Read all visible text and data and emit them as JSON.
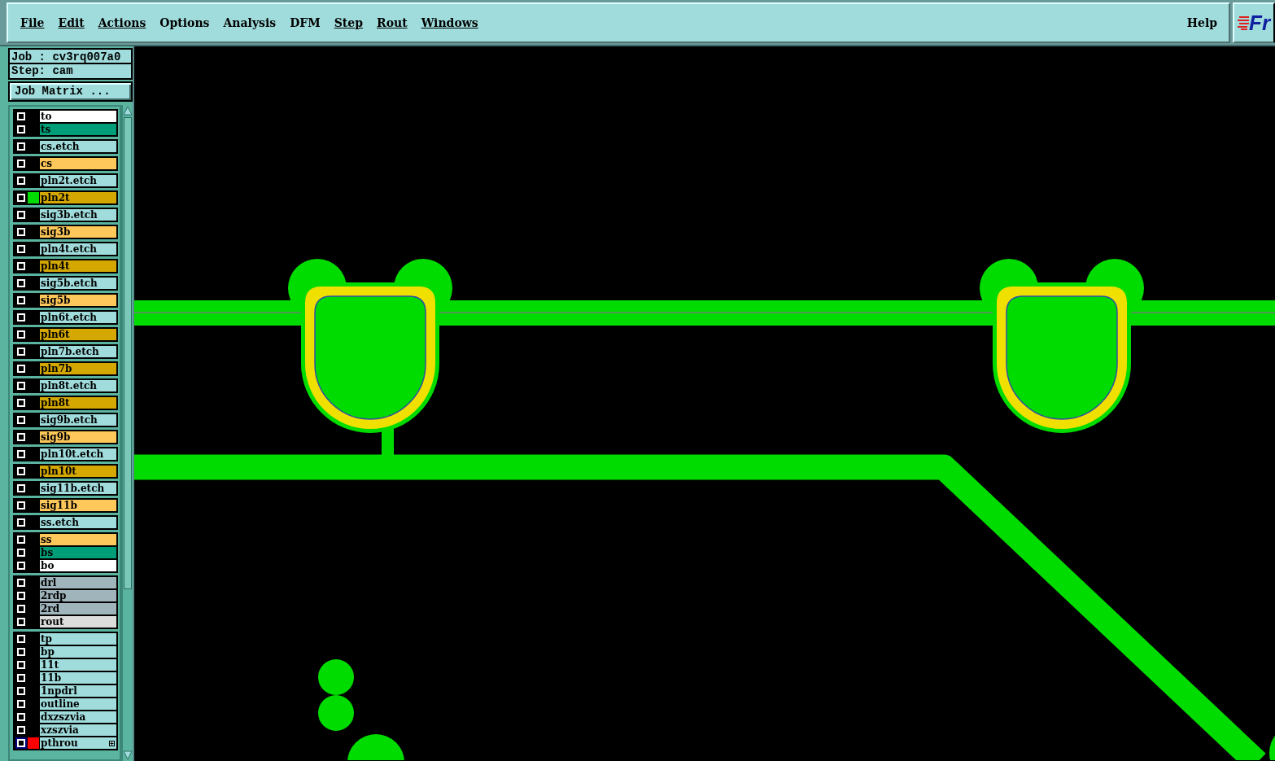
{
  "menu_bar": {
    "items": [
      {
        "label": "File",
        "underline": true
      },
      {
        "label": "Edit",
        "underline": true
      },
      {
        "label": "Actions",
        "underline": true
      },
      {
        "label": "Options",
        "underline": false
      },
      {
        "label": "Analysis",
        "underline": false
      },
      {
        "label": "DFM",
        "underline": false
      },
      {
        "label": "Step",
        "underline": true
      },
      {
        "label": "Rout",
        "underline": true
      },
      {
        "label": "Windows",
        "underline": true
      }
    ],
    "help": "Help",
    "logo": "Fr"
  },
  "job_info": {
    "job": "Job : cv3rq007a0",
    "step": "Step: cam",
    "job_matrix_button": "Job Matrix ..."
  },
  "layer_groups": [
    {
      "layers": [
        {
          "name": "to",
          "color": "#ffffff",
          "highlighted": false
        },
        {
          "name": "ts",
          "color": "#009e78",
          "highlighted": false
        }
      ]
    },
    {
      "layers": [
        {
          "name": "cs.etch",
          "color": "#a0dcdc",
          "highlighted": false
        }
      ]
    },
    {
      "layers": [
        {
          "name": "cs",
          "color": "#ffc85a",
          "highlighted": false
        }
      ]
    },
    {
      "layers": [
        {
          "name": "pln2t.etch",
          "color": "#a0dcdc",
          "highlighted": false
        }
      ]
    },
    {
      "layers": [
        {
          "name": "pln2t",
          "color": "#d4a800",
          "highlighted": false,
          "marker": {
            "color": "#00dc00"
          }
        }
      ]
    },
    {
      "layers": [
        {
          "name": "sig3b.etch",
          "color": "#a0dcdc",
          "highlighted": false
        }
      ]
    },
    {
      "layers": [
        {
          "name": "sig3b",
          "color": "#ffc85a",
          "highlighted": false
        }
      ]
    },
    {
      "layers": [
        {
          "name": "pln4t.etch",
          "color": "#a0dcdc",
          "highlighted": false
        }
      ]
    },
    {
      "layers": [
        {
          "name": "pln4t",
          "color": "#d4a800",
          "highlighted": false
        }
      ]
    },
    {
      "layers": [
        {
          "name": "sig5b.etch",
          "color": "#a0dcdc",
          "highlighted": false
        }
      ]
    },
    {
      "layers": [
        {
          "name": "sig5b",
          "color": "#ffc85a",
          "highlighted": false
        }
      ]
    },
    {
      "layers": [
        {
          "name": "pln6t.etch",
          "color": "#a0dcdc",
          "highlighted": false
        }
      ]
    },
    {
      "layers": [
        {
          "name": "pln6t",
          "color": "#d4a800",
          "highlighted": false
        }
      ]
    },
    {
      "layers": [
        {
          "name": "pln7b.etch",
          "color": "#a0dcdc",
          "highlighted": false
        }
      ]
    },
    {
      "layers": [
        {
          "name": "pln7b",
          "color": "#d4a800",
          "highlighted": false
        }
      ]
    },
    {
      "layers": [
        {
          "name": "pln8t.etch",
          "color": "#a0dcdc",
          "highlighted": false
        }
      ]
    },
    {
      "layers": [
        {
          "name": "pln8t",
          "color": "#d4a800",
          "highlighted": false
        }
      ]
    },
    {
      "layers": [
        {
          "name": "sig9b.etch",
          "color": "#a0dcdc",
          "highlighted": false
        }
      ]
    },
    {
      "layers": [
        {
          "name": "sig9b",
          "color": "#ffc85a",
          "highlighted": false
        }
      ]
    },
    {
      "layers": [
        {
          "name": "pln10t.etch",
          "color": "#a0dcdc",
          "highlighted": false
        }
      ]
    },
    {
      "layers": [
        {
          "name": "pln10t",
          "color": "#d4a800",
          "highlighted": false
        }
      ]
    },
    {
      "layers": [
        {
          "name": "sig11b.etch",
          "color": "#a0dcdc",
          "highlighted": false
        }
      ]
    },
    {
      "layers": [
        {
          "name": "sig11b",
          "color": "#ffc85a",
          "highlighted": false
        }
      ]
    },
    {
      "layers": [
        {
          "name": "ss.etch",
          "color": "#a0dcdc",
          "highlighted": false
        }
      ]
    },
    {
      "layers": [
        {
          "name": "ss",
          "color": "#ffc85a",
          "highlighted": false
        },
        {
          "name": "bs",
          "color": "#009e78",
          "highlighted": false
        },
        {
          "name": "bo",
          "color": "#ffffff",
          "highlighted": false
        }
      ]
    },
    {
      "layers": [
        {
          "name": "drl",
          "color": "#a0b4bc",
          "highlighted": false
        },
        {
          "name": "2rdp",
          "color": "#a0b4bc",
          "highlighted": false
        },
        {
          "name": "2rd",
          "color": "#a0b4bc",
          "highlighted": false
        },
        {
          "name": "rout",
          "color": "#dcdcdc",
          "highlighted": false
        }
      ]
    },
    {
      "layers": [
        {
          "name": "tp",
          "color": "#a0dcdc",
          "highlighted": false
        },
        {
          "name": "bp",
          "color": "#a0dcdc",
          "highlighted": false
        },
        {
          "name": "11t",
          "color": "#a0dcdc",
          "highlighted": false
        },
        {
          "name": "11b",
          "color": "#a0dcdc",
          "highlighted": false
        },
        {
          "name": "1npdrl",
          "color": "#a0dcdc",
          "highlighted": false
        },
        {
          "name": "outline",
          "color": "#a0dcdc",
          "highlighted": false
        },
        {
          "name": "dxzszvia",
          "color": "#a0dcdc",
          "highlighted": false
        },
        {
          "name": "xzszvia",
          "color": "#a0dcdc",
          "highlighted": false
        },
        {
          "name": "pthrou",
          "color": "#a0dcdc",
          "highlighted": true,
          "marker": {
            "color": "#ff0000"
          },
          "has_attributes": true
        }
      ]
    }
  ]
}
